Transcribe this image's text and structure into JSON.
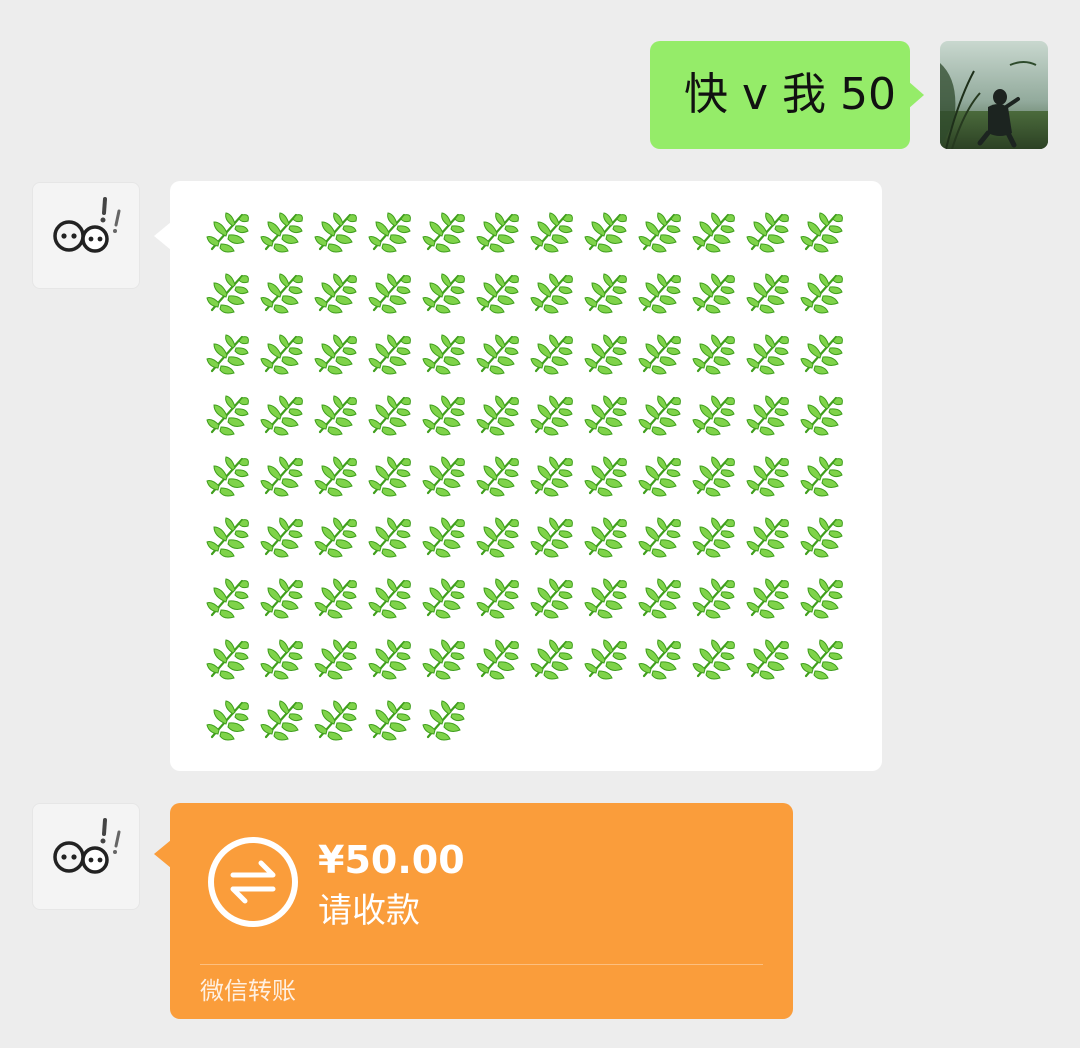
{
  "messages": {
    "outgoing": {
      "text": "快 v 我 50",
      "bubble_color": "#95ec69"
    },
    "leaf_message": {
      "emoji": "herb-leaf-icon",
      "count": 101,
      "bubble_color": "#ffffff"
    },
    "transfer": {
      "amount": "¥50.00",
      "status": "请收款",
      "footer": "微信转账",
      "card_color": "#fa9d3b",
      "icon": "transfer-arrows-icon"
    }
  },
  "avatars": {
    "me": "user-avatar-photo",
    "contact": "wechat-logo-icon"
  },
  "colors": {
    "background": "#ededed",
    "leaf_dark": "#3f9e1c",
    "leaf_light": "#7fd34a"
  }
}
